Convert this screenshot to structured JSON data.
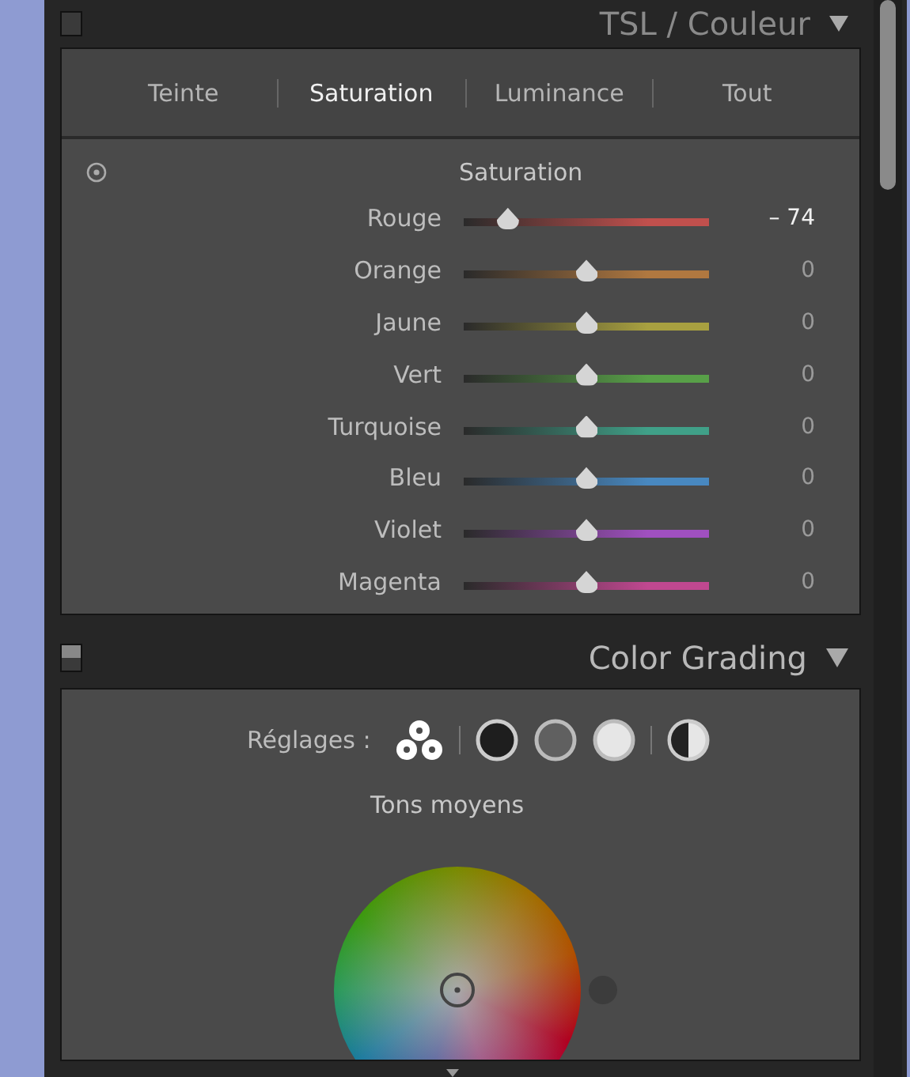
{
  "hsl_panel": {
    "title": "TSL / Couleur",
    "tabs": [
      {
        "label": "Teinte",
        "selected": false
      },
      {
        "label": "Saturation",
        "selected": true
      },
      {
        "label": "Luminance",
        "selected": false
      },
      {
        "label": "Tout",
        "selected": false
      }
    ],
    "section_title": "Saturation",
    "sliders": [
      {
        "name": "Rouge",
        "level": 0.18,
        "reading": "– 74",
        "color": "#c0504d"
      },
      {
        "name": "Orange",
        "level": 0.5,
        "reading": "0",
        "color": "#b07840"
      },
      {
        "name": "Jaune",
        "level": 0.5,
        "reading": "0",
        "color": "#a8a040"
      },
      {
        "name": "Vert",
        "level": 0.5,
        "reading": "0",
        "color": "#58a048"
      },
      {
        "name": "Turquoise",
        "level": 0.5,
        "reading": "0",
        "color": "#40a088"
      },
      {
        "name": "Bleu",
        "level": 0.5,
        "reading": "0",
        "color": "#4888c0"
      },
      {
        "name": "Violet",
        "level": 0.5,
        "reading": "0",
        "color": "#a050c0"
      },
      {
        "name": "Magenta",
        "level": 0.5,
        "reading": "0",
        "color": "#c04890"
      }
    ]
  },
  "color_grading": {
    "title": "Color Grading",
    "adjust_label": "Réglages :",
    "modes": [
      {
        "kind": "three"
      },
      {
        "kind": "dark"
      },
      {
        "kind": "mid"
      },
      {
        "kind": "light"
      },
      {
        "kind": "global"
      }
    ],
    "wheel_label": "Tons moyens"
  }
}
